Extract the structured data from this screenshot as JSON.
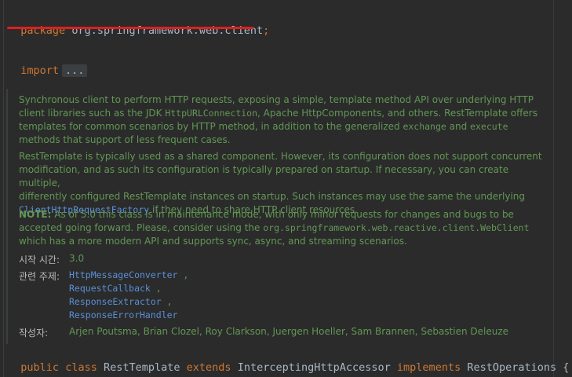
{
  "code": {
    "package_keyword": "package",
    "package_name": "org.springframework.web.client",
    "package_semicolon": ";",
    "import_keyword": "import",
    "import_fold": "...",
    "class_decl": {
      "kw_public": "public",
      "kw_class": "class",
      "class_name": "RestTemplate",
      "kw_extends": "extends",
      "super_class": "InterceptingHttpAccessor",
      "kw_implements": "implements",
      "interface": "RestOperations",
      "brace": "{"
    }
  },
  "doc": {
    "para1_a": "Synchronous client to perform HTTP requests, exposing a simple, template method API over underlying HTTP",
    "para1_b_pre": "client libraries such as the JDK ",
    "para1_b_code": "HttpURLConnection",
    "para1_b_post": ", Apache HttpComponents, and others. RestTemplate offers",
    "para1_c": "templates for common scenarios by HTTP method, in addition to the generalized ",
    "para1_c_code1": "exchange",
    "para1_c_mid": " and ",
    "para1_c_code2": "execute",
    "para1_d": "methods that support of less frequent cases.",
    "para2_a": "RestTemplate is typically used as a shared component. However, its configuration does not support concurrent",
    "para2_b": "modification, and as such its configuration is typically prepared on startup. If necessary, you can create multiple,",
    "para2_c": "differently configured RestTemplate instances on startup. Such instances may use the same the underlying",
    "para2_d_link": "ClientHttpRequestFactory",
    "para2_d_post": " if they need to share HTTP client resources.",
    "note_label": "NOTE:",
    "para3_a": " As of 5.0 this class is in maintenance mode, with only minor requests for changes and bugs to be",
    "para3_b_pre": "accepted going forward. Please, consider using the ",
    "para3_b_code": "org.springframework.web.reactive.client.WebClient",
    "para3_c": "which has a more modern API and supports sync, async, and streaming scenarios.",
    "since_label": "시작 시간:",
    "since_value": "3.0",
    "see_label": "관련 주제:",
    "see_links": [
      "HttpMessageConverter",
      "RequestCallback",
      "ResponseExtractor",
      "ResponseErrorHandler"
    ],
    "see_sep": ",",
    "author_label": "작성자:",
    "author_value": "Arjen Poutsma, Brian Clozel, Roy Clarkson, Juergen Hoeller, Sam Brannen, Sebastien Deleuze"
  }
}
